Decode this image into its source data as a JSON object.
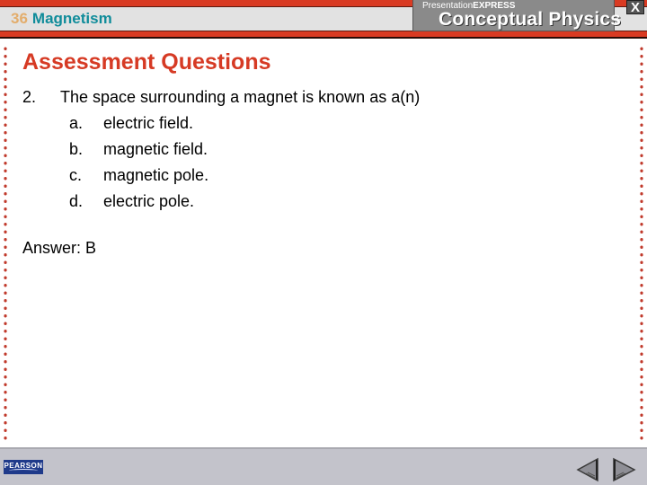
{
  "header": {
    "chapter_number": "36",
    "chapter_title": "Magnetism",
    "brand_sub_light": "Presentation",
    "brand_sub_bold": "EXPRESS",
    "brand_title": "Conceptual Physics",
    "close_label": "X"
  },
  "slide": {
    "title": "Assessment Questions",
    "question": {
      "number": "2.",
      "text": "The space surrounding a magnet is known as a(n)",
      "options": [
        {
          "letter": "a.",
          "text": "electric field."
        },
        {
          "letter": "b.",
          "text": "magnetic field."
        },
        {
          "letter": "c.",
          "text": "magnetic pole."
        },
        {
          "letter": "d.",
          "text": "electric pole."
        }
      ]
    },
    "answer": "Answer: B"
  },
  "footer": {
    "logo_text": "PEARSON",
    "prev_icon": "triangle-left-icon",
    "next_icon": "triangle-right-icon"
  },
  "colors": {
    "header_red": "#d93a22",
    "chapter_number": "#e3ad6c",
    "chapter_title": "#0f8c9a",
    "slide_title": "#d63a24",
    "pearson_blue": "#1f3a8a"
  }
}
